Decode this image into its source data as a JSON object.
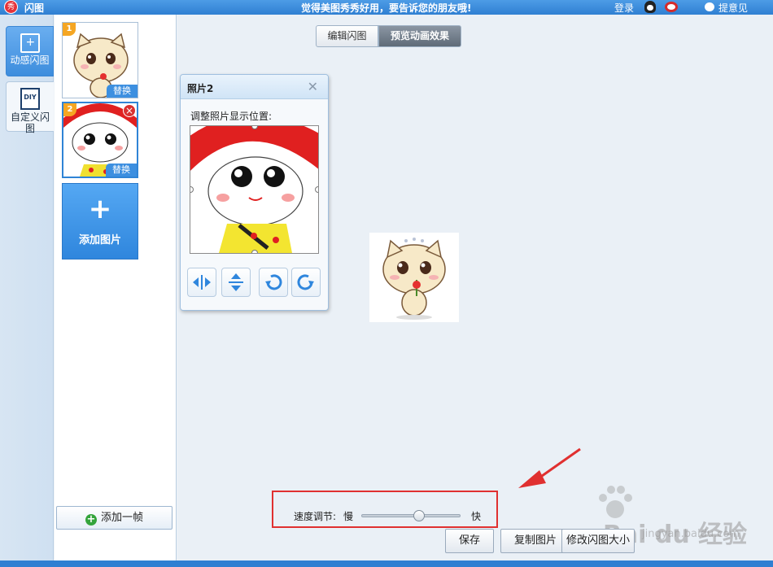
{
  "titlebar": {
    "logo_text": "秀",
    "app_title": "闪图",
    "slogan": "觉得美图秀秀好用，要告诉您的朋友哦!",
    "login": "登录",
    "feedback": "提意见"
  },
  "mode_tabs": [
    {
      "label": "动感闪图"
    },
    {
      "label": "自定义闪图",
      "icon_text": "DIY"
    }
  ],
  "frames": [
    {
      "number": "1",
      "replace_label": "替换"
    },
    {
      "number": "2",
      "replace_label": "替换",
      "delete_glyph": "×"
    }
  ],
  "add_image": {
    "plus": "+",
    "label": "添加图片"
  },
  "add_frame": {
    "icon": "+",
    "label": "添加一帧"
  },
  "view_tabs": {
    "edit": "编辑闪图",
    "preview": "预览动画效果"
  },
  "crop_dialog": {
    "title": "照片2",
    "close": "✕",
    "hint": "调整照片显示位置:",
    "tools": [
      "flip-horizontal",
      "flip-vertical",
      "rotate-left",
      "rotate-right"
    ]
  },
  "speed": {
    "label": "速度调节:",
    "slow": "慢",
    "fast": "快",
    "value": 0.58
  },
  "buttons": {
    "save": "保存",
    "copy": "复制图片",
    "modify": "修改闪图大小"
  },
  "watermark": {
    "brand": "Bai du 经验",
    "url": "jingyan.baidu.com"
  },
  "colors": {
    "accent": "#2f7fd2",
    "highlight_box": "#e03030",
    "arrow": "#e03030"
  }
}
